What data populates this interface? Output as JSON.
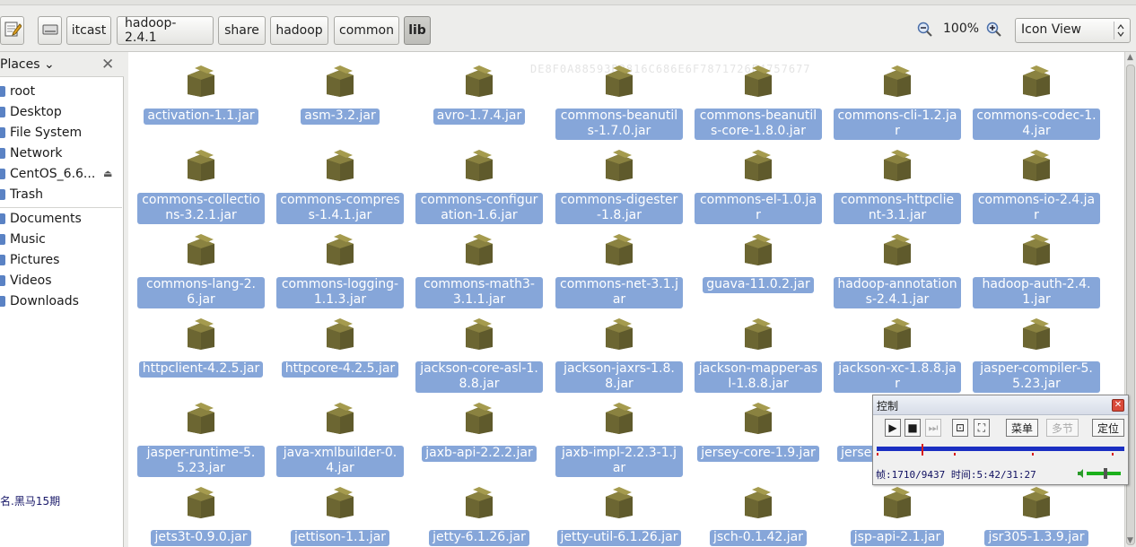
{
  "toolbar": {
    "breadcrumbs": [
      "itcast",
      "hadoop-2.4.1",
      "share",
      "hadoop",
      "common",
      "lib"
    ],
    "active_crumb": "lib",
    "zoom": "100%",
    "view_mode": "Icon View",
    "icons": [
      "edit-location-icon",
      "drive-icon",
      "zoom-out-icon",
      "zoom-in-icon"
    ]
  },
  "sidebar": {
    "title": "Places",
    "items": [
      {
        "label": "root"
      },
      {
        "label": "Desktop"
      },
      {
        "label": "File System"
      },
      {
        "label": "Network"
      },
      {
        "label": "CentOS_6.6..."
      },
      {
        "label": "Trash"
      },
      {
        "label": "Documents"
      },
      {
        "label": "Music"
      },
      {
        "label": "Pictures"
      },
      {
        "label": "Videos"
      },
      {
        "label": "Downloads"
      }
    ],
    "footer_text": "名.黑马15期"
  },
  "watermark": "DE8F0A88593B2816C686E6F7871726E4757677",
  "files": [
    "activation-1.1.jar",
    "asm-3.2.jar",
    "avro-1.7.4.jar",
    "commons-beanutils-1.7.0.jar",
    "commons-beanutils-core-1.8.0.jar",
    "commons-cli-1.2.jar",
    "commons-codec-1.4.jar",
    "commons-collections-3.2.1.jar",
    "commons-compress-1.4.1.jar",
    "commons-configuration-1.6.jar",
    "commons-digester-1.8.jar",
    "commons-el-1.0.jar",
    "commons-httpclient-3.1.jar",
    "commons-io-2.4.jar",
    "commons-lang-2.6.jar",
    "commons-logging-1.1.3.jar",
    "commons-math3-3.1.1.jar",
    "commons-net-3.1.jar",
    "guava-11.0.2.jar",
    "hadoop-annotations-2.4.1.jar",
    "hadoop-auth-2.4.1.jar",
    "httpclient-4.2.5.jar",
    "httpcore-4.2.5.jar",
    "jackson-core-asl-1.8.8.jar",
    "jackson-jaxrs-1.8.8.jar",
    "jackson-mapper-asl-1.8.8.jar",
    "jackson-xc-1.8.8.jar",
    "jasper-compiler-5.5.23.jar",
    "jasper-runtime-5.5.23.jar",
    "java-xmlbuilder-0.4.jar",
    "jaxb-api-2.2.2.jar",
    "jaxb-impl-2.2.3-1.jar",
    "jersey-core-1.9.jar",
    "jersey-json-1.9.jar",
    "",
    "jets3t-0.9.0.jar",
    "jettison-1.1.jar",
    "jetty-6.1.26.jar",
    "jetty-util-6.1.26.jar",
    "jsch-0.1.42.jar",
    "jsp-api-2.1.jar",
    "jsr305-1.3.9.jar"
  ],
  "control_panel": {
    "title": "控制",
    "menu_label": "菜单",
    "multi_label": "多节",
    "locate_label": "定位",
    "frame_label": "帧",
    "frame_value": "1710/9437",
    "time_label": "时间",
    "time_value": "5:42/31:27",
    "progress": 0.18
  },
  "colors": {
    "selection": "#86a6d9",
    "track": "#1b2fc2",
    "marker": "#d81c1c"
  }
}
